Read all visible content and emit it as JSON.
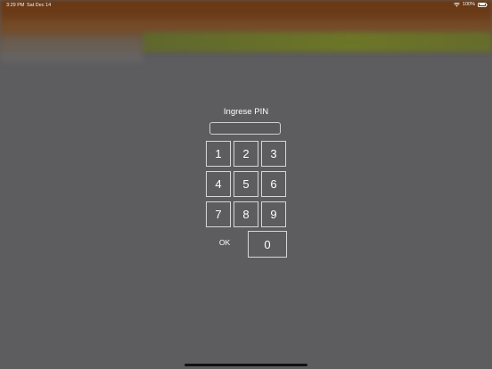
{
  "status_bar": {
    "time": "3:29 PM",
    "date": "Sat Dec 14",
    "battery_text": "100%",
    "wifi_icon": "wifi-icon",
    "battery_icon": "battery-icon"
  },
  "pin_pad": {
    "title": "Ingrese PIN",
    "input_value": "",
    "keys": [
      "1",
      "2",
      "3",
      "4",
      "5",
      "6",
      "7",
      "8",
      "9"
    ],
    "zero": "0",
    "ok_label": "OK"
  },
  "colors": {
    "overlay": "#5d5c5e",
    "key_border": "#d6d6d6",
    "text": "#ffffff"
  }
}
